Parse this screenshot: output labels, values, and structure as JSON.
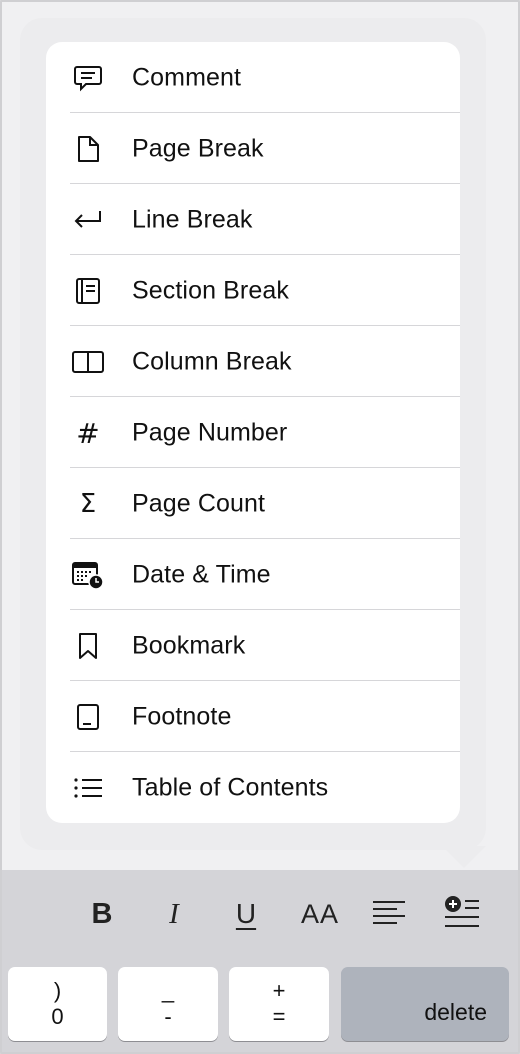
{
  "menu": {
    "items": [
      {
        "label": "Comment",
        "icon": "comment-icon"
      },
      {
        "label": "Page Break",
        "icon": "page-break-icon"
      },
      {
        "label": "Line Break",
        "icon": "line-break-icon"
      },
      {
        "label": "Section Break",
        "icon": "section-break-icon"
      },
      {
        "label": "Column Break",
        "icon": "column-break-icon"
      },
      {
        "label": "Page Number",
        "icon": "hash-icon",
        "glyph": "#"
      },
      {
        "label": "Page Count",
        "icon": "sigma-icon",
        "glyph": "Σ"
      },
      {
        "label": "Date & Time",
        "icon": "calendar-clock-icon"
      },
      {
        "label": "Bookmark",
        "icon": "bookmark-icon"
      },
      {
        "label": "Footnote",
        "icon": "footnote-icon"
      },
      {
        "label": "Table of Contents",
        "icon": "list-icon"
      }
    ]
  },
  "toolbar": {
    "bold": "B",
    "italic": "I",
    "underline": "U",
    "font_size": "AA",
    "align_icon": "align-left-icon",
    "insert_icon": "insert-icon"
  },
  "keyboard": {
    "keys": [
      {
        "top": ")",
        "bottom": "0"
      },
      {
        "top": "_",
        "bottom": "-"
      },
      {
        "top": "+",
        "bottom": "="
      }
    ],
    "delete_label": "delete"
  }
}
